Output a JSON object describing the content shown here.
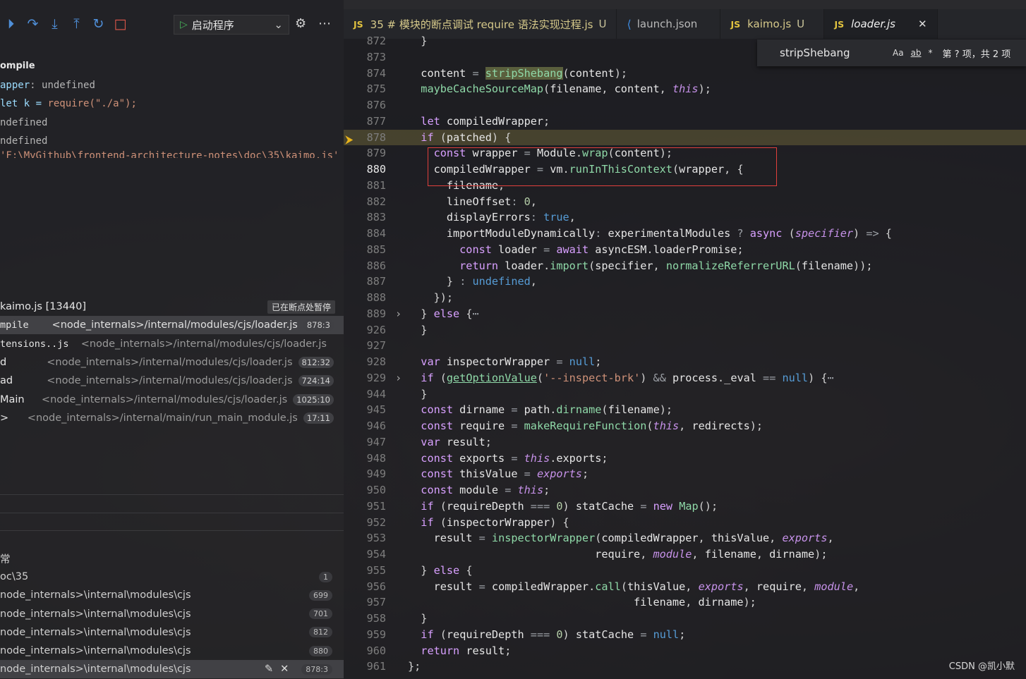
{
  "debug_toolbar": {
    "icons": [
      "continue-icon",
      "step-over-icon",
      "step-into-icon",
      "step-out-icon",
      "restart-icon",
      "stop-icon"
    ],
    "launch_config": "启动程序"
  },
  "variables": {
    "scope": "ompile",
    "rows": [
      {
        "key": "apper",
        "val": "undefined"
      },
      {
        "key": "let k = ",
        "val": "require(\"./a\");"
      },
      {
        "key": "",
        "val": "ndefined"
      },
      {
        "key": "",
        "val": "ndefined"
      },
      {
        "key": "",
        "val": "'F:\\MyGithub\\frontend-architecture-notes\\doc\\35\\kaimo.js'"
      }
    ]
  },
  "call_stack": {
    "thread": "kaimo.js [13440]",
    "status": "已在断点处暂停",
    "frames": [
      {
        "fn": "mpile",
        "path": "<node_internals>/internal/modules/cjs/loader.js",
        "pos": "878:3"
      },
      {
        "fn": "tensions..js",
        "path": "<node_internals>/internal/modules/cjs/loader.js",
        "pos": ""
      },
      {
        "fn": "d",
        "path": "<node_internals>/internal/modules/cjs/loader.js",
        "pos": "812:32"
      },
      {
        "fn": "ad",
        "path": "<node_internals>/internal/modules/cjs/loader.js",
        "pos": "724:14"
      },
      {
        "fn": "Main",
        "path": "<node_internals>/internal/modules/cjs/loader.js",
        "pos": "1025:10"
      },
      {
        "fn": ">",
        "path": "<node_internals>/internal/main/run_main_module.js",
        "pos": "17:11"
      }
    ]
  },
  "breakpoints": {
    "title": "常",
    "items": [
      {
        "label": "oc\\35",
        "count": "1"
      },
      {
        "label": "node_internals>\\internal\\modules\\cjs",
        "count": "699"
      },
      {
        "label": "node_internals>\\internal\\modules\\cjs",
        "count": "701"
      },
      {
        "label": "node_internals>\\internal\\modules\\cjs",
        "count": "812"
      },
      {
        "label": "node_internals>\\internal\\modules\\cjs",
        "count": "880"
      },
      {
        "label": "node_internals>\\internal\\modules\\cjs",
        "count": "878:3"
      }
    ]
  },
  "tabs": [
    {
      "icon": "JS",
      "label": "35 # 模块的断点调试 require 语法实现过程.js",
      "badge": "U"
    },
    {
      "icon": "vscode",
      "label": "launch.json",
      "badge": ""
    },
    {
      "icon": "JS",
      "label": "kaimo.js",
      "badge": "U"
    },
    {
      "icon": "JS",
      "label": "loader.js",
      "badge": "",
      "active": true
    }
  ],
  "find_widget": {
    "query": "stripShebang",
    "opts": [
      "Aa",
      "ab",
      "*"
    ],
    "result": "第 ? 项，共 2 项"
  },
  "editor": {
    "current_line": "880",
    "lines": [
      {
        "n": "872",
        "html": "  <span class='pu'>}</span>"
      },
      {
        "n": "873",
        "html": ""
      },
      {
        "n": "874",
        "html": "  <span class='id'>content</span> <span class='op'>=</span> <span class='fn match'>stripShebang</span><span class='pu'>(</span><span class='id'>content</span><span class='pu'>);</span>"
      },
      {
        "n": "875",
        "html": "  <span class='fn'>maybeCacheSourceMap</span><span class='pu'>(</span><span class='id'>filename</span><span class='pu'>,</span> <span class='id'>content</span><span class='pu'>,</span> <span class='thisk'>this</span><span class='pu'>);</span>"
      },
      {
        "n": "876",
        "html": ""
      },
      {
        "n": "877",
        "html": "  <span class='kw'>let</span> <span class='id'>compiledWrapper</span><span class='pu'>;</span>"
      },
      {
        "n": "878",
        "html": "  <span class='kw'>if</span> <span class='pu'>(</span><span class='id'>patched</span><span class='pu'>) {</span>"
      },
      {
        "n": "879",
        "html": "    <span class='kw'>const</span> <span class='id'>wrapper</span> <span class='op'>=</span> <span class='id'>Module</span><span class='pu'>.</span><span class='fn'>wrap</span><span class='pu'>(</span><span class='id'>content</span><span class='pu'>);</span>"
      },
      {
        "n": "880",
        "html": "    <span class='id'>compiledWrapper</span> <span class='op'>=</span> <span class='id'>vm</span><span class='pu'>.</span><span class='fn'>runInThisContext</span><span class='pu'>(</span><span class='id'>wrapper</span><span class='pu'>,</span> <span class='pu'>{</span>"
      },
      {
        "n": "881",
        "html": "      <span class='id'>filename</span><span class='pu'>,</span>"
      },
      {
        "n": "882",
        "html": "      <span class='id'>lineOffset</span><span class='op'>:</span> <span class='num'>0</span><span class='pu'>,</span>"
      },
      {
        "n": "883",
        "html": "      <span class='id'>displayErrors</span><span class='op'>:</span> <span class='kw2'>true</span><span class='pu'>,</span>"
      },
      {
        "n": "884",
        "html": "      <span class='id'>importModuleDynamically</span><span class='op'>:</span> <span class='id'>experimentalModules</span> <span class='op'>?</span> <span class='kw'>async</span> <span class='pu'>(</span><span class='par'>specifier</span><span class='pu'>)</span> <span class='op'>=&gt;</span> <span class='pu'>{</span>"
      },
      {
        "n": "885",
        "html": "        <span class='kw'>const</span> <span class='id'>loader</span> <span class='op'>=</span> <span class='kw'>await</span> <span class='id'>asyncESM</span><span class='pu'>.</span><span class='id'>loaderPromise</span><span class='pu'>;</span>"
      },
      {
        "n": "886",
        "html": "        <span class='kw'>return</span> <span class='id'>loader</span><span class='pu'>.</span><span class='fn'>import</span><span class='pu'>(</span><span class='id'>specifier</span><span class='pu'>,</span> <span class='fn'>normalizeReferrerURL</span><span class='pu'>(</span><span class='id'>filename</span><span class='pu'>));</span>"
      },
      {
        "n": "887",
        "html": "      <span class='pu'>}</span> <span class='op'>:</span> <span class='kw2'>undefined</span><span class='pu'>,</span>"
      },
      {
        "n": "888",
        "html": "    <span class='pu'>});</span>"
      },
      {
        "n": "889",
        "html": "  <span class='pu'>}</span> <span class='kw'>else</span> <span class='pu'>{</span><span class='op'>⋯</span>",
        "fold": "›"
      },
      {
        "n": "926",
        "html": "  <span class='pu'>}</span>"
      },
      {
        "n": "927",
        "html": ""
      },
      {
        "n": "928",
        "html": "  <span class='kw'>var</span> <span class='id'>inspectorWrapper</span> <span class='op'>=</span> <span class='kw2'>null</span><span class='pu'>;</span>"
      },
      {
        "n": "929",
        "html": "  <span class='kw'>if</span> <span class='pu'>(</span><span class='fn' style='text-decoration:underline'>getOptionValue</span><span class='pu'>(</span><span class='str'>'--inspect-brk'</span><span class='pu'>)</span> <span class='op'>&amp;&amp;</span> <span class='id'>process</span><span class='pu'>.</span><span class='id'>_eval</span> <span class='op'>==</span> <span class='kw2'>null</span><span class='pu'>)</span> <span class='pu'>{</span><span class='op'>⋯</span>",
        "fold": "›"
      },
      {
        "n": "944",
        "html": "  <span class='pu'>}</span>"
      },
      {
        "n": "945",
        "html": "  <span class='kw'>const</span> <span class='id'>dirname</span> <span class='op'>=</span> <span class='id'>path</span><span class='pu'>.</span><span class='fn'>dirname</span><span class='pu'>(</span><span class='id'>filename</span><span class='pu'>);</span>"
      },
      {
        "n": "946",
        "html": "  <span class='kw'>const</span> <span class='id'>require</span> <span class='op'>=</span> <span class='fn'>makeRequireFunction</span><span class='pu'>(</span><span class='thisk'>this</span><span class='pu'>,</span> <span class='id'>redirects</span><span class='pu'>);</span>"
      },
      {
        "n": "947",
        "html": "  <span class='kw'>var</span> <span class='id'>result</span><span class='pu'>;</span>"
      },
      {
        "n": "948",
        "html": "  <span class='kw'>const</span> <span class='id'>exports</span> <span class='op'>=</span> <span class='thisk'>this</span><span class='pu'>.</span><span class='id'>exports</span><span class='pu'>;</span>"
      },
      {
        "n": "949",
        "html": "  <span class='kw'>const</span> <span class='id'>thisValue</span> <span class='op'>=</span> <span class='par'>exports</span><span class='pu'>;</span>"
      },
      {
        "n": "950",
        "html": "  <span class='kw'>const</span> <span class='id'>module</span> <span class='op'>=</span> <span class='thisk'>this</span><span class='pu'>;</span>"
      },
      {
        "n": "951",
        "html": "  <span class='kw'>if</span> <span class='pu'>(</span><span class='id'>requireDepth</span> <span class='op'>===</span> <span class='num'>0</span><span class='pu'>)</span> <span class='id'>statCache</span> <span class='op'>=</span> <span class='kw'>new</span> <span class='fn'>Map</span><span class='pu'>();</span>"
      },
      {
        "n": "952",
        "html": "  <span class='kw'>if</span> <span class='pu'>(</span><span class='id'>inspectorWrapper</span><span class='pu'>)</span> <span class='pu'>{</span>"
      },
      {
        "n": "953",
        "html": "    <span class='id'>result</span> <span class='op'>=</span> <span class='fn'>inspectorWrapper</span><span class='pu'>(</span><span class='id'>compiledWrapper</span><span class='pu'>,</span> <span class='id'>thisValue</span><span class='pu'>,</span> <span class='par'>exports</span><span class='pu'>,</span>"
      },
      {
        "n": "954",
        "html": "                             <span class='id'>require</span><span class='pu'>,</span> <span class='par'>module</span><span class='pu'>,</span> <span class='id'>filename</span><span class='pu'>,</span> <span class='id'>dirname</span><span class='pu'>);</span>"
      },
      {
        "n": "955",
        "html": "  <span class='pu'>}</span> <span class='kw'>else</span> <span class='pu'>{</span>"
      },
      {
        "n": "956",
        "html": "    <span class='id'>result</span> <span class='op'>=</span> <span class='id'>compiledWrapper</span><span class='pu'>.</span><span class='fn'>call</span><span class='pu'>(</span><span class='id'>thisValue</span><span class='pu'>,</span> <span class='par'>exports</span><span class='pu'>,</span> <span class='id'>require</span><span class='pu'>,</span> <span class='par'>module</span><span class='pu'>,</span>"
      },
      {
        "n": "957",
        "html": "                                   <span class='id'>filename</span><span class='pu'>,</span> <span class='id'>dirname</span><span class='pu'>);</span>"
      },
      {
        "n": "958",
        "html": "  <span class='pu'>}</span>"
      },
      {
        "n": "959",
        "html": "  <span class='kw'>if</span> <span class='pu'>(</span><span class='id'>requireDepth</span> <span class='op'>===</span> <span class='num'>0</span><span class='pu'>)</span> <span class='id'>statCache</span> <span class='op'>=</span> <span class='kw2'>null</span><span class='pu'>;</span>"
      },
      {
        "n": "960",
        "html": "  <span class='kw'>return</span> <span class='id'>result</span><span class='pu'>;</span>"
      },
      {
        "n": "961",
        "html": "<span class='pu'>};</span>"
      }
    ]
  },
  "watermark": "CSDN @凯小默"
}
